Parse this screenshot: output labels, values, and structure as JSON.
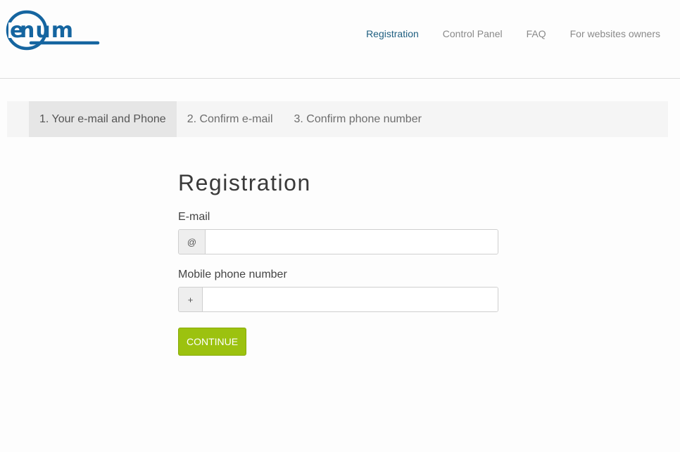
{
  "logo": {
    "text": "enum",
    "color": "#1565a0"
  },
  "nav": {
    "items": [
      {
        "label": "Registration",
        "active": true
      },
      {
        "label": "Control Panel",
        "active": false
      },
      {
        "label": "FAQ",
        "active": false
      },
      {
        "label": "For websites owners",
        "active": false
      }
    ]
  },
  "steps": [
    {
      "label": "1. Your e-mail and Phone",
      "active": true
    },
    {
      "label": "2. Confirm e-mail",
      "active": false
    },
    {
      "label": "3. Confirm phone number",
      "active": false
    }
  ],
  "form": {
    "title": "Registration",
    "email": {
      "label": "E-mail",
      "prefix": "@",
      "value": "",
      "placeholder": ""
    },
    "phone": {
      "label": "Mobile phone number",
      "prefix": "+",
      "value": "",
      "placeholder": ""
    },
    "submit_label": "CONTINUE"
  },
  "colors": {
    "accent": "#9cc20f",
    "nav_active": "#1f5f80",
    "brand": "#1565a0"
  }
}
